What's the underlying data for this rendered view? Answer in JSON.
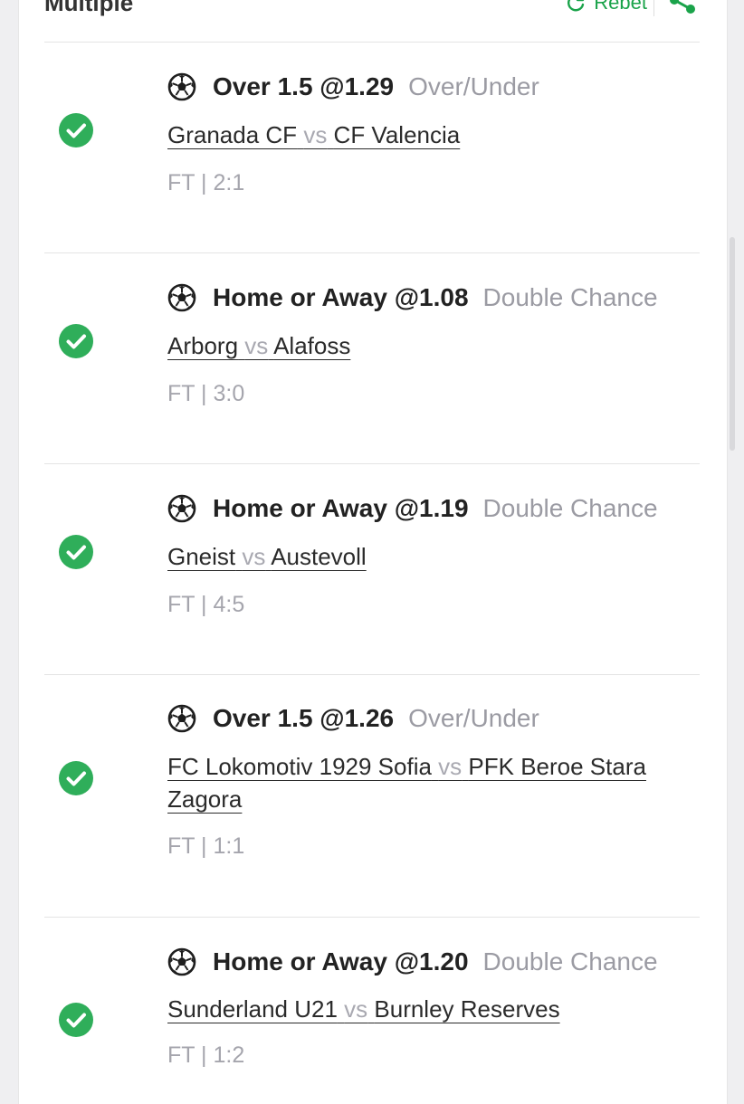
{
  "header": {
    "title": "Multiple",
    "rebet_label": "Rebet",
    "rebet_icon": "refresh-icon",
    "share_icon": "share-icon"
  },
  "colors": {
    "accent_green": "#1aa34a",
    "check_green": "#2fae5a",
    "muted_text": "#9b9ba3"
  },
  "bets": [
    {
      "selection": "Over 1.5 @1.29",
      "market": "Over/Under",
      "home": "Granada CF",
      "vs": "vs",
      "away": "CF Valencia",
      "result": "FT | 2:1",
      "status": "won",
      "sport_icon": "soccer-ball-icon"
    },
    {
      "selection": "Home or Away @1.08",
      "market": "Double Chance",
      "home": "Arborg",
      "vs": "vs",
      "away": "Alafoss",
      "result": "FT | 3:0",
      "status": "won",
      "sport_icon": "soccer-ball-icon"
    },
    {
      "selection": "Home or Away @1.19",
      "market": "Double Chance",
      "home": "Gneist",
      "vs": "vs",
      "away": "Austevoll",
      "result": "FT | 4:5",
      "status": "won",
      "sport_icon": "soccer-ball-icon"
    },
    {
      "selection": "Over 1.5 @1.26",
      "market": "Over/Under",
      "home": "FC Lokomotiv 1929 Sofia",
      "vs": "vs",
      "away": "PFK Beroe Stara Zagora",
      "result": "FT | 1:1",
      "status": "won",
      "sport_icon": "soccer-ball-icon"
    },
    {
      "selection": "Home or Away @1.20",
      "market": "Double Chance",
      "home": "Sunderland U21",
      "vs": "vs",
      "away": "Burnley Reserves",
      "result": "FT | 1:2",
      "status": "won",
      "sport_icon": "soccer-ball-icon"
    }
  ]
}
